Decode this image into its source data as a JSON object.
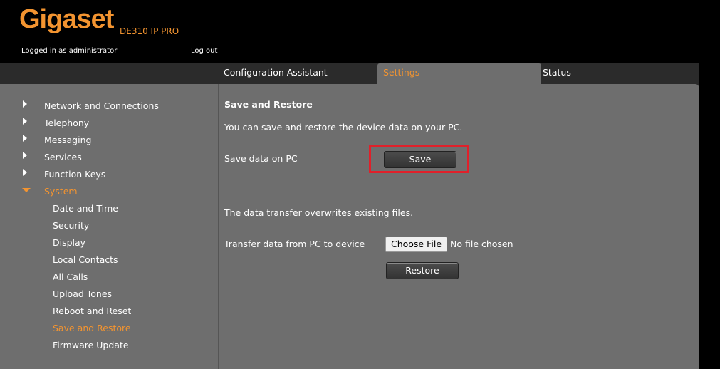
{
  "header": {
    "brand": "Gigaset",
    "model": "DE310 IP PRO",
    "logged_in": "Logged in as administrator",
    "logout": "Log out"
  },
  "tabs": [
    {
      "label": "Configuration Assistant"
    },
    {
      "label": "Settings",
      "active": true
    },
    {
      "label": "Status"
    }
  ],
  "sidebar": {
    "items": [
      {
        "label": "Network and Connections"
      },
      {
        "label": "Telephony"
      },
      {
        "label": "Messaging"
      },
      {
        "label": "Services"
      },
      {
        "label": "Function Keys"
      },
      {
        "label": "System",
        "expanded": true
      }
    ],
    "sub_items": [
      {
        "label": "Date and Time"
      },
      {
        "label": "Security"
      },
      {
        "label": "Display"
      },
      {
        "label": "Local Contacts"
      },
      {
        "label": "All Calls"
      },
      {
        "label": "Upload Tones"
      },
      {
        "label": "Reboot and Reset"
      },
      {
        "label": "Save and Restore",
        "active": true
      },
      {
        "label": "Firmware Update"
      }
    ]
  },
  "main": {
    "title": "Save and Restore",
    "description": "You can save and restore the device data on your PC.",
    "save_label": "Save data on PC",
    "save_button": "Save",
    "overwrite_note": "The data transfer overwrites existing files.",
    "transfer_label": "Transfer data from PC to device",
    "choose_file": "Choose File",
    "no_file": "No file chosen",
    "restore_button": "Restore"
  },
  "colors": {
    "accent": "#f39430",
    "highlight": "#e0202a",
    "panel": "#6e6e6e"
  }
}
